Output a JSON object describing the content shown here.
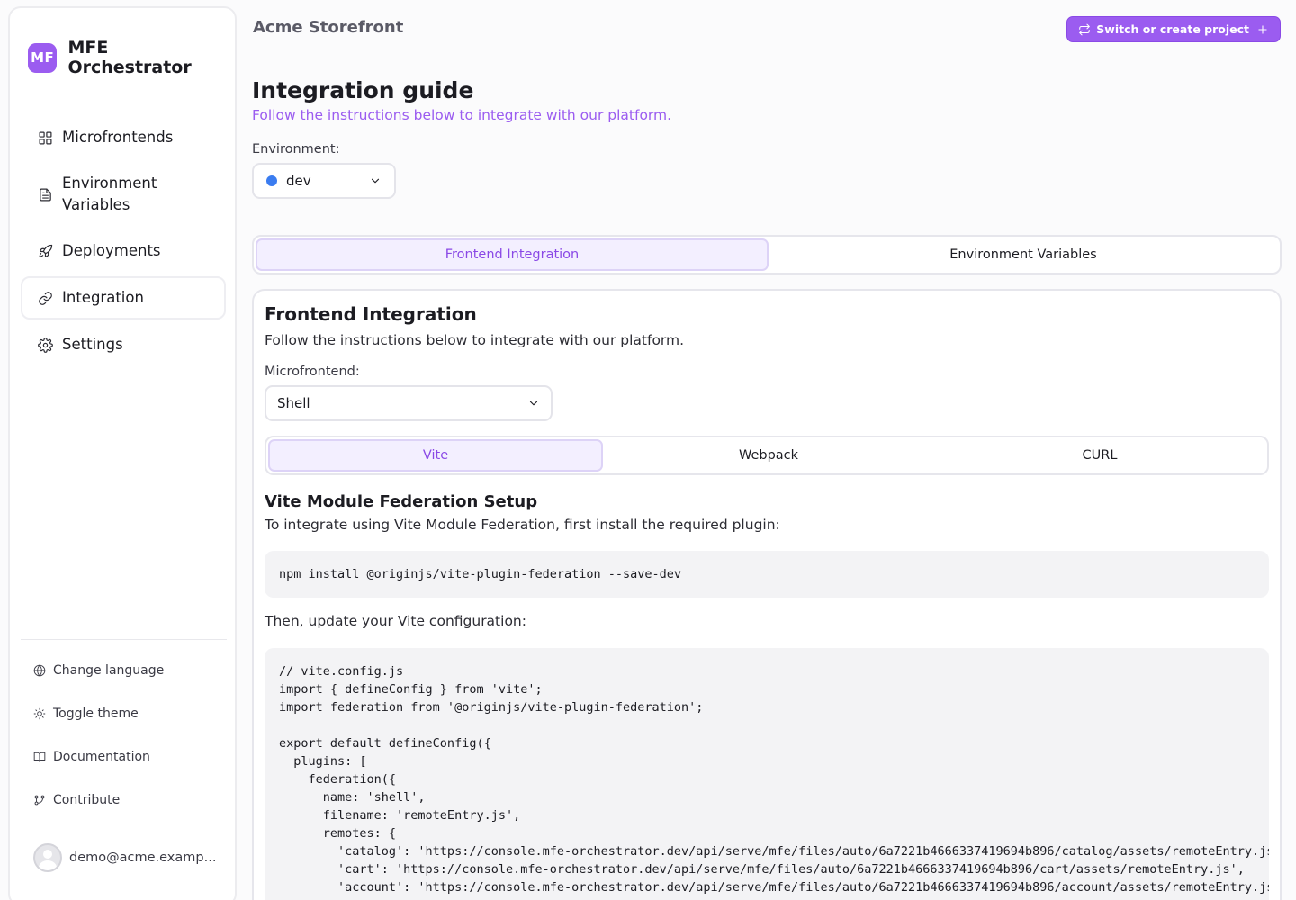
{
  "app": {
    "logo_text": "MF",
    "name": "MFE Orchestrator",
    "accent_color": "#9b5cf0"
  },
  "sidebar": {
    "items": [
      {
        "label": "Microfrontends",
        "icon": "grid-icon"
      },
      {
        "label": "Environment Variables",
        "icon": "file-text-icon"
      },
      {
        "label": "Deployments",
        "icon": "rocket-icon"
      },
      {
        "label": "Integration",
        "icon": "link-icon",
        "active": true
      },
      {
        "label": "Settings",
        "icon": "gear-icon"
      }
    ],
    "footer": [
      {
        "label": "Change language",
        "icon": "globe-icon"
      },
      {
        "label": "Toggle theme",
        "icon": "sun-icon"
      },
      {
        "label": "Documentation",
        "icon": "book-icon"
      },
      {
        "label": "Contribute",
        "icon": "git-branch-icon"
      }
    ],
    "user_email": "demo@acme.examp..."
  },
  "header": {
    "project_name": "Acme Storefront",
    "switch_button": "Switch or create project"
  },
  "page": {
    "title": "Integration guide",
    "subtitle": "Follow the instructions below to integrate with our platform.",
    "environment_label": "Environment:",
    "environment_value": "dev",
    "environment_color": "#3a7cf0",
    "tabs": [
      "Frontend Integration",
      "Environment Variables"
    ]
  },
  "card": {
    "title": "Frontend Integration",
    "description": "Follow the instructions below to integrate with our platform.",
    "microfrontend_label": "Microfrontend:",
    "microfrontend_value": "Shell",
    "tabs": [
      "Vite",
      "Webpack",
      "CURL"
    ],
    "setup_title": "Vite Module Federation Setup",
    "setup_desc": "To integrate using Vite Module Federation, first install the required plugin:",
    "install_cmd": "npm install @originjs/vite-plugin-federation --save-dev",
    "then_text": "Then, update your Vite configuration:",
    "config_code": "// vite.config.js\nimport { defineConfig } from 'vite';\nimport federation from '@originjs/vite-plugin-federation';\n\nexport default defineConfig({\n  plugins: [\n    federation({\n      name: 'shell',\n      filename: 'remoteEntry.js',\n      remotes: {\n        'catalog': 'https://console.mfe-orchestrator.dev/api/serve/mfe/files/auto/6a7221b4666337419694b896/catalog/assets/remoteEntry.js',\n        'cart': 'https://console.mfe-orchestrator.dev/api/serve/mfe/files/auto/6a7221b4666337419694b896/cart/assets/remoteEntry.js',\n        'account': 'https://console.mfe-orchestrator.dev/api/serve/mfe/files/auto/6a7221b4666337419694b896/account/assets/remoteEntry.js',\n      },"
  }
}
